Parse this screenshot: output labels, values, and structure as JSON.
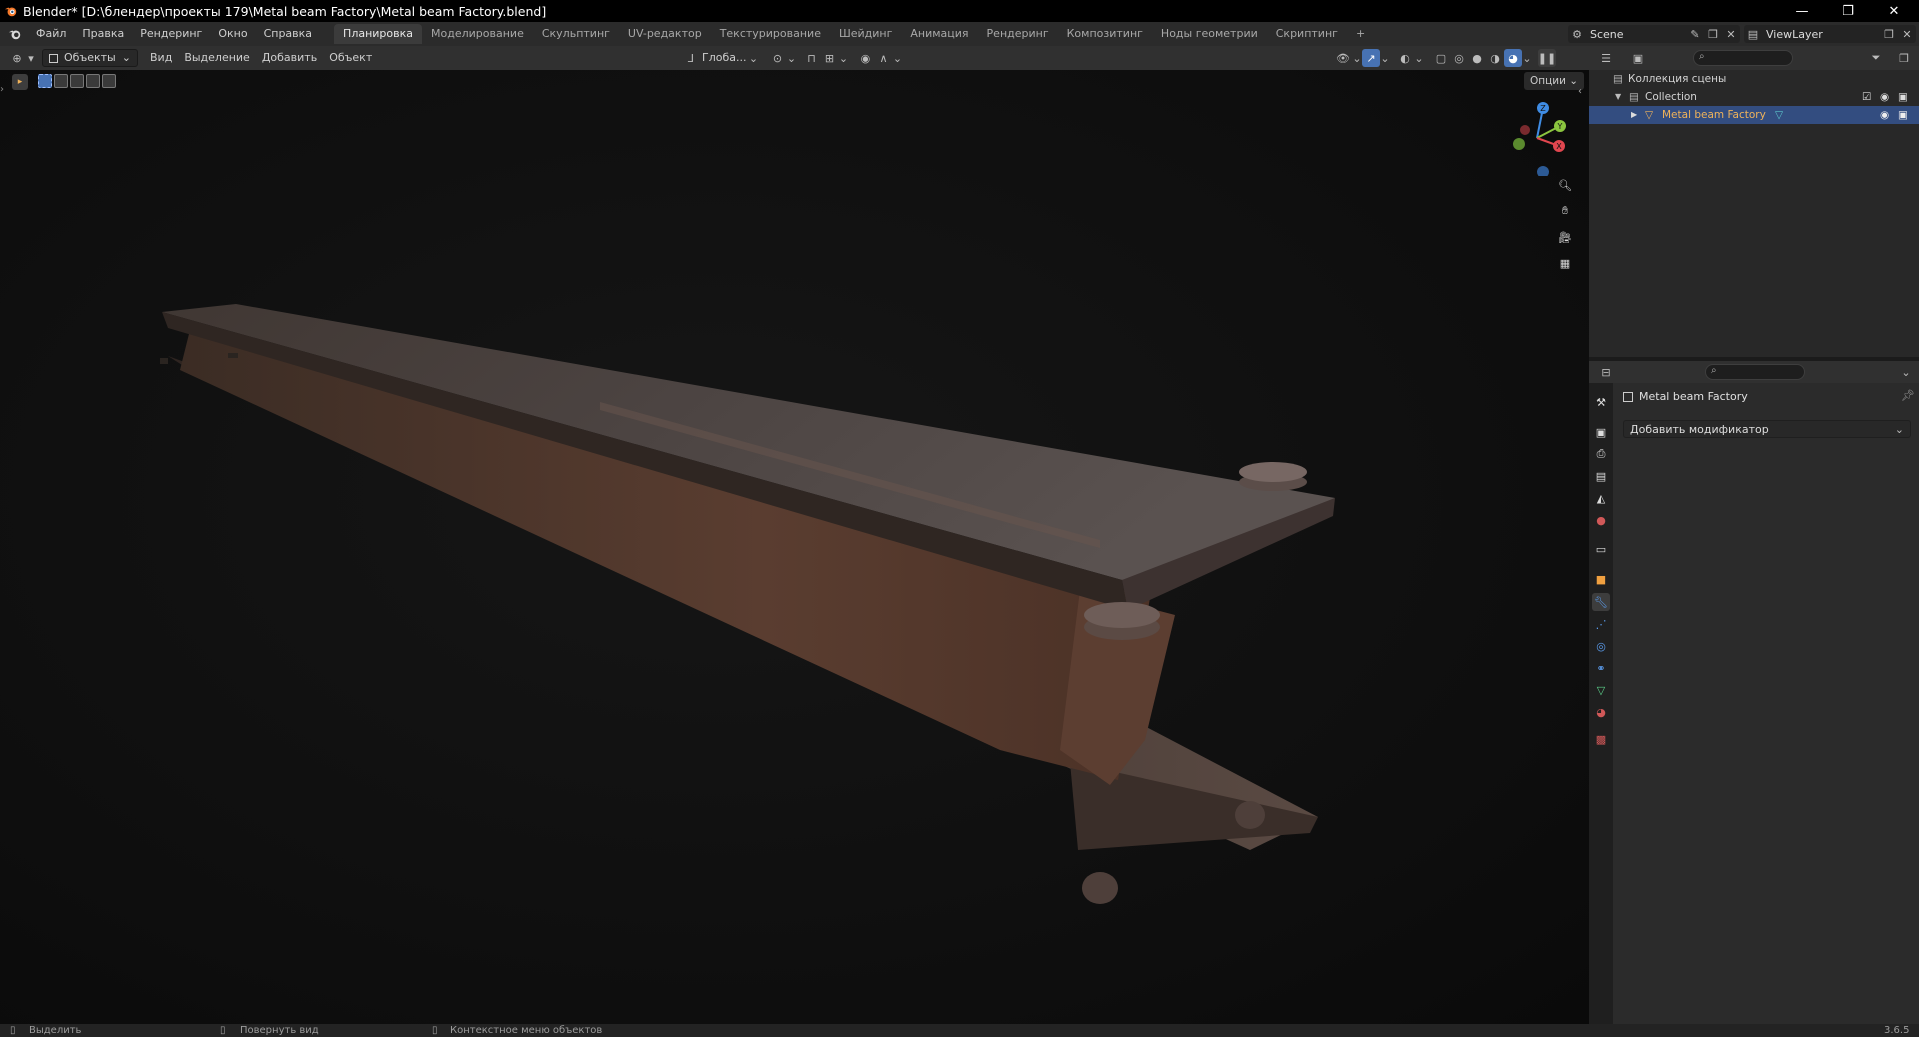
{
  "titlebar": {
    "title": "Blender* [D:\\блендер\\проекты 179\\Metal beam Factory\\Metal beam Factory.blend]",
    "minimize_icon": "minimize-icon",
    "restore_icon": "restore-icon",
    "close_icon": "close-icon"
  },
  "menu": {
    "items": [
      "Файл",
      "Правка",
      "Рендеринг",
      "Окно",
      "Справка"
    ]
  },
  "workspaces": {
    "tabs": [
      "Планировка",
      "Моделирование",
      "Скульптинг",
      "UV-редактор",
      "Текстурирование",
      "Шейдинг",
      "Анимация",
      "Рендеринг",
      "Композитинг",
      "Ноды геометрии",
      "Скриптинг"
    ],
    "active": "Планировка",
    "add_label": "+"
  },
  "scene": {
    "label": "Scene"
  },
  "viewlayer": {
    "label": "ViewLayer"
  },
  "viewport_header": {
    "mode": "Объекты",
    "menus": [
      "Вид",
      "Выделение",
      "Добавить",
      "Объект"
    ],
    "transform_orientation": "Глоба...",
    "options_label": "Опции"
  },
  "navigation_gizmo": {
    "axes": {
      "z": "Z",
      "y": "Y",
      "x": "X"
    },
    "colors": {
      "x": "#e2464f",
      "y": "#8bc53f",
      "z": "#3f8ce4"
    }
  },
  "outliner": {
    "scene_collection": "Коллекция сцены",
    "collection": "Collection",
    "object": "Metal beam Factory",
    "selected_color": "#334d80",
    "object_text_color": "#f0b35a"
  },
  "properties": {
    "object_name": "Metal beam Factory",
    "add_modifier_label": "Добавить модификатор"
  },
  "statusbar": {
    "select_label": "Выделить",
    "rotate_label": "Повернуть вид",
    "context_label": "Контекстное меню объектов",
    "version": "3.6.5"
  }
}
